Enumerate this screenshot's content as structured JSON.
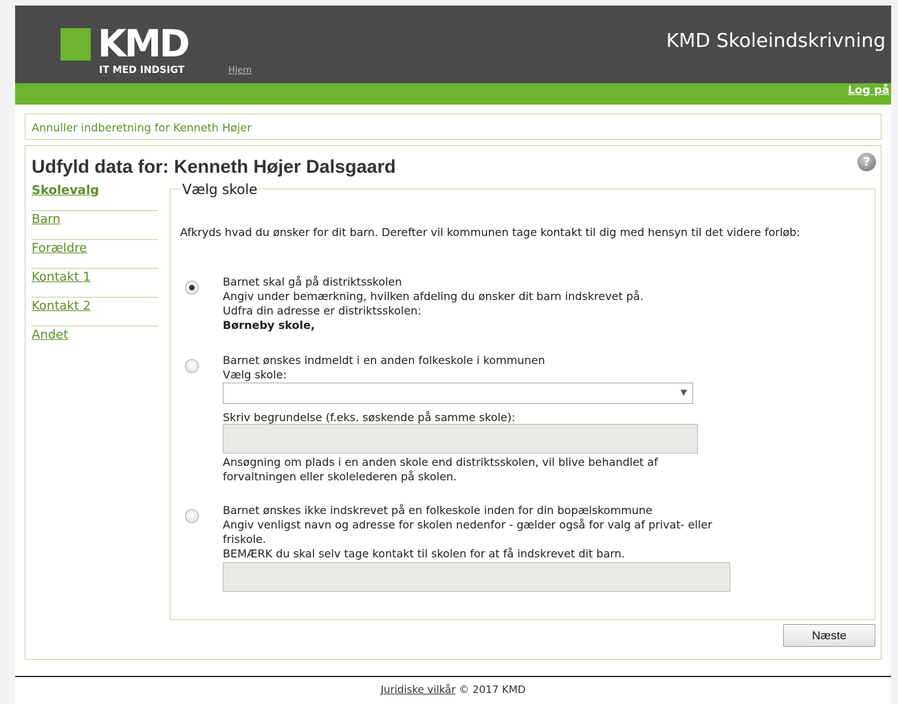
{
  "header": {
    "logo_text": "KMD",
    "tagline": "IT MED INDSIGT",
    "home_link": "Hjem",
    "app_title": "KMD Skoleindskrivning",
    "logout": "Log på"
  },
  "cancel_link": "Annuller indberetning for Kenneth Højer",
  "page_title": "Udfyld data for: Kenneth Højer Dalsgaard",
  "sidenav": {
    "items": [
      {
        "label": "Skolevalg",
        "active": true
      },
      {
        "label": "Barn"
      },
      {
        "label": "Forældre"
      },
      {
        "label": "Kontakt 1"
      },
      {
        "label": "Kontakt 2"
      },
      {
        "label": "Andet"
      }
    ]
  },
  "form": {
    "legend": "Vælg skole",
    "intro": "Afkryds hvad du ønsker for dit barn. Derefter vil kommunen tage kontakt til dig med hensyn til det videre forløb:",
    "options": [
      {
        "selected": true,
        "line1": "Barnet skal gå på distriktsskolen",
        "line2": "Angiv under bemærkning, hvilken afdeling du ønsker dit barn indskrevet på.",
        "line3": "Udfra din adresse er distriktsskolen:",
        "line4": "Børneby skole,"
      },
      {
        "selected": false,
        "line1": "Barnet ønskes indmeldt i en anden folkeskole i kommunen",
        "select_label": "Vælg skole:",
        "select_value": "",
        "reason_label": "Skriv begrundelse (f.eks. søskende på samme skole):",
        "reason_value": "",
        "note": "Ansøgning om plads i en anden skole end distriktsskolen, vil blive behandlet af forvaltningen eller skolelederen på skolen."
      },
      {
        "selected": false,
        "line1": "Barnet ønskes ikke indskrevet på en folkeskole inden for din bopælskommune",
        "line2": "Angiv venligst navn og adresse for skolen nedenfor - gælder også for valg af privat- eller friskole.",
        "line3": "BEMÆRK du skal selv tage kontakt til skolen for at få indskrevet dit barn.",
        "input_value": ""
      }
    ]
  },
  "next_button": "Næste",
  "footer": {
    "terms_link": "Juridiske vilkår",
    "copyright": "© 2017 KMD"
  },
  "colors": {
    "header_bg": "#4a4a4a",
    "brand_green": "#6cb52d",
    "link_green": "#5e8f2a"
  },
  "icons": {
    "help": "help-question-icon",
    "select_arrow": "triangle-down-icon"
  }
}
